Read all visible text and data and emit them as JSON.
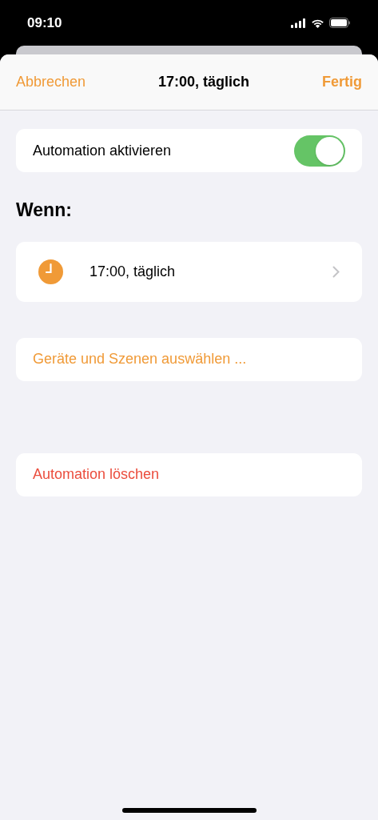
{
  "status_bar": {
    "time": "09:10"
  },
  "nav": {
    "cancel": "Abbrechen",
    "title": "17:00, täglich",
    "done": "Fertig"
  },
  "toggle_row": {
    "label": "Automation aktivieren",
    "on": true
  },
  "section_title": "Wenn:",
  "trigger": {
    "label": "17:00, täglich"
  },
  "select_devices": {
    "label": "Geräte und Szenen auswählen ..."
  },
  "delete": {
    "label": "Automation löschen"
  }
}
